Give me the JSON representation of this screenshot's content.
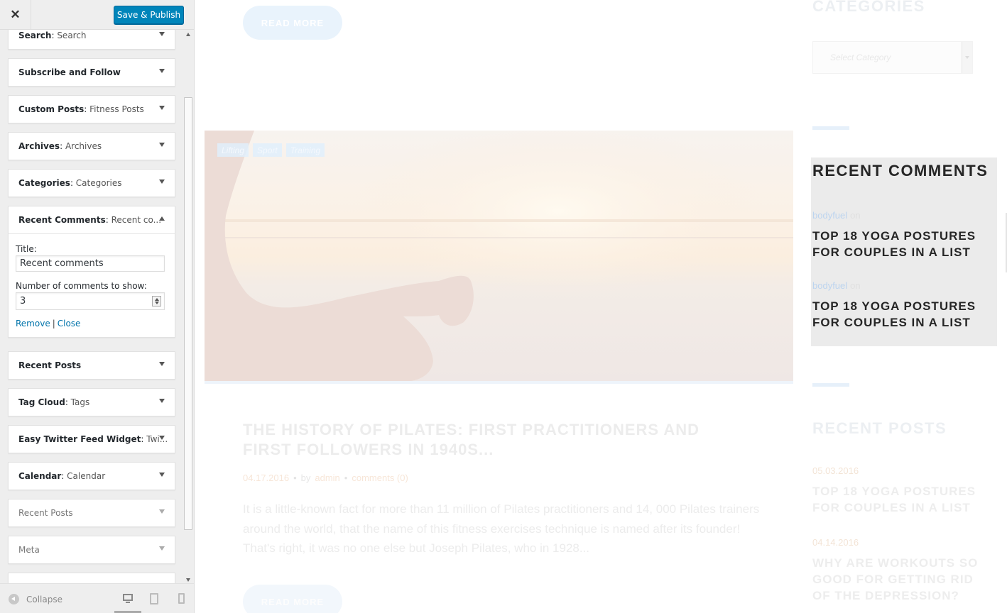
{
  "customizer": {
    "publish_label": "Save & Publish",
    "close_glyph": "✕",
    "widgets": [
      {
        "name": "Search",
        "sub": "Search"
      },
      {
        "name": "Subscribe and Follow",
        "sub": ""
      },
      {
        "name": "Custom Posts",
        "sub": "Fitness Posts"
      },
      {
        "name": "Archives",
        "sub": "Archives"
      },
      {
        "name": "Categories",
        "sub": "Categories"
      },
      {
        "name": "Recent Comments",
        "sub": "Recent co..."
      },
      {
        "name": "Recent Posts",
        "sub": ""
      },
      {
        "name": "Tag Cloud",
        "sub": "Tags"
      },
      {
        "name": "Easy Twitter Feed Widget",
        "sub": "Twi..."
      },
      {
        "name": "Calendar",
        "sub": "Calendar"
      },
      {
        "name": "Recent Posts",
        "sub": ""
      },
      {
        "name": "Meta",
        "sub": ""
      }
    ],
    "expanded": {
      "title_label": "Title:",
      "title_value": "Recent comments",
      "count_label": "Number of comments to show:",
      "count_value": "3",
      "remove_label": "Remove",
      "separator": "|",
      "close_label": "Close"
    },
    "collapse_label": "Collapse"
  },
  "preview": {
    "read_more": "READ MORE",
    "tags": [
      "Lifting",
      "Sport",
      "Training"
    ],
    "post_title": "THE HISTORY OF PILATES: FIRST PRACTITIONERS AND FIRST FOLLOWERS IN 1940S...",
    "post_date": "04.17.2016",
    "post_by": "by",
    "post_author": "admin",
    "post_comments": "comments (0)",
    "meta_dot": "•",
    "post_excerpt": "It is a little-known fact for more than 11 million of Pilates practitioners and 14, 000 Pilates trainers around the world, that the name of this fitness exercises technique is named after its founder! That's right, it was no one else but Joseph Pilates, who in 1928...",
    "sidebar": {
      "categories_heading": "CATEGORIES",
      "category_placeholder": "Select Category",
      "recent_comments_heading": "RECENT COMMENTS",
      "comments": [
        {
          "author": "bodyfuel",
          "on": "on",
          "post": "TOP 18 YOGA POSTURES FOR COUPLES IN A LIST"
        },
        {
          "author": "bodyfuel",
          "on": "on",
          "post": "TOP 18 YOGA POSTURES FOR COUPLES IN A LIST"
        }
      ],
      "recent_posts_heading": "RECENT POSTS",
      "posts": [
        {
          "date": "05.03.2016",
          "title": "TOP 18 YOGA POSTURES FOR COUPLES IN A LIST"
        },
        {
          "date": "04.14.2016",
          "title": "WHY ARE WORKOUTS SO GOOD FOR GETTING RID OF THE DEPRESSION?"
        }
      ]
    }
  },
  "colors": {
    "publish_button": "#0085ba",
    "link": "#0073aa",
    "recent_comments_bg": "#ebebeb"
  },
  "icons": [
    "close-icon",
    "chevron-down-icon",
    "chevron-up-icon",
    "collapse-icon",
    "desktop-icon",
    "tablet-icon",
    "mobile-icon",
    "spinner-icon",
    "dropdown-arrow-icon"
  ]
}
